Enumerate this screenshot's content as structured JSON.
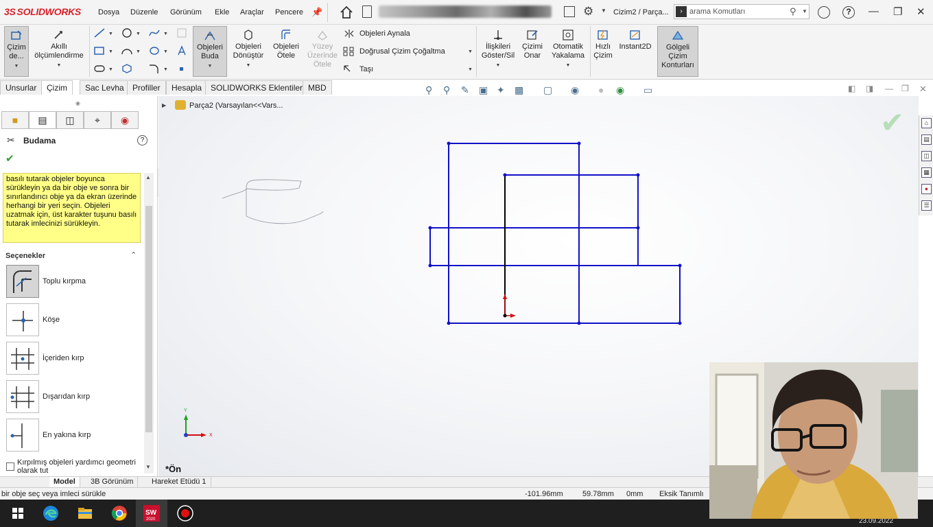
{
  "app": {
    "logo_prefix": "3S",
    "logo_text": "SOLIDWORKS",
    "menu": [
      "Dosya",
      "Düzenle",
      "Görünüm",
      "Ekle",
      "Araçlar",
      "Pencere"
    ],
    "document_title": "Cizim2 / Parça...",
    "search_placeholder": "arama Komutları"
  },
  "ribbon": {
    "sketch_label": "Çizim de...",
    "smart_dim_label": "Akıllı ölçümlendirme",
    "trim_label": "Objeleri Buda",
    "convert_label": "Objeleri Dönüştür",
    "offset_label": "Objeleri Ötele",
    "surface_offset_label": "Yüzey Üzerinde Ötele",
    "mirror_label": "Objeleri Aynala",
    "linear_pattern_label": "Doğrusal Çizim Çoğaltma",
    "move_label": "Taşı",
    "relations_label": "İlişkileri Göster/Sil",
    "repair_label": "Çizimi Onar",
    "snap_label": "Otomatik Yakalama",
    "rapid_label": "Hızlı Çizim",
    "instant2d_label": "Instant2D",
    "shaded_label": "Gölgeli Çizim Konturları"
  },
  "tabs": [
    "Unsurlar",
    "Çizim",
    "Sac Levha",
    "Profiller",
    "Hesapla",
    "SOLIDWORKS Eklentileri",
    "MBD"
  ],
  "active_tab": "Çizim",
  "property_manager": {
    "title": "Budama",
    "help": "?",
    "message": "basılı tutarak objeler boyunca sürükleyin ya da bir obje ve sonra bir sınırlandırıcı obje ya da ekran üzerinde herhangi bir yeri seçin. Objeleri uzatmak için, üst karakter tuşunu basılı tutarak imlecinizi sürükleyin.",
    "options_header": "Seçenekler",
    "options": [
      "Toplu kırpma",
      "Köşe",
      "İçeriden kırp",
      "Dışarıdan kırp",
      "En yakına kırp"
    ],
    "selected_option": "Toplu kırpma",
    "checkbox_label": "Kırpılmış objeleri yardımcı geometri olarak tut"
  },
  "graphics": {
    "tree_text": "Parça2  (Varsayılan<<Vars...",
    "view_label": "*Ön",
    "triad_x": "X",
    "triad_y": "Y"
  },
  "bottom_tabs": [
    "Model",
    "3B Görünüm",
    "Hareket Etüdü 1"
  ],
  "active_bottom_tab": "Model",
  "status": {
    "message": "bir obje seç veya imleci sürükle",
    "x": "-101.96mm",
    "y": "59.78mm",
    "z": "0mm",
    "state": "Eksik Tanımlı"
  },
  "taskbar": {
    "date": "23.09.2022",
    "items": [
      "windows-start",
      "edge",
      "file-explorer",
      "chrome",
      "solidworks-2020",
      "recorder"
    ]
  },
  "colors": {
    "sketch_line": "#1010c8",
    "construction_line": "#000000",
    "origin_red": "#d01010",
    "accent_green": "#2e9c2e",
    "message_bg": "#ffff88"
  }
}
